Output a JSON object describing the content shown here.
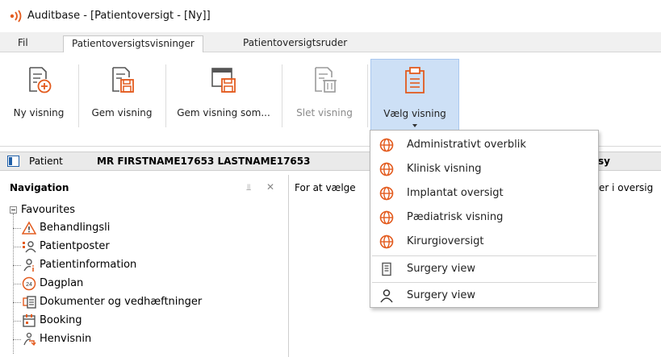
{
  "window": {
    "title": "Auditbase - [Patientoversigt - [Ny]]",
    "logo_icon": "signal-waves-icon"
  },
  "tabs": [
    {
      "label": "Fil",
      "active": false
    },
    {
      "label": "Patientoversigtsvisninger",
      "active": true
    },
    {
      "label": "Patientoversigtsruder",
      "active": false
    }
  ],
  "ribbon": {
    "buttons": [
      {
        "label": "Ny visning",
        "icon": "new-document-plus-icon",
        "enabled": true
      },
      {
        "label": "Gem visning",
        "icon": "save-document-icon",
        "enabled": true
      },
      {
        "label": "Gem visning som...",
        "icon": "save-as-window-icon",
        "enabled": true
      },
      {
        "label": "Slet visning",
        "icon": "delete-document-icon",
        "enabled": false
      },
      {
        "label": "Vælg visning",
        "icon": "clipboard-list-icon",
        "enabled": true,
        "selected": true
      }
    ]
  },
  "patient_bar": {
    "label": "Patient",
    "name": "MR FIRSTNAME17653 LASTNAME17653",
    "right_fragment": "sy"
  },
  "navigation": {
    "title": "Navigation",
    "root_label": "Favourites",
    "items": [
      {
        "label": "Behandlingsli",
        "icon": "warning-triangle-icon"
      },
      {
        "label": "Patientposter",
        "icon": "patient-records-icon"
      },
      {
        "label": "Patientinformation",
        "icon": "patient-info-icon"
      },
      {
        "label": "Dagplan",
        "icon": "24-hours-icon"
      },
      {
        "label": "Dokumenter og vedhæftninger",
        "icon": "documents-attachments-icon"
      },
      {
        "label": "Booking",
        "icon": "calendar-icon"
      },
      {
        "label": "Henvisnin",
        "icon": "referral-icon"
      }
    ]
  },
  "content": {
    "hint_left": "For at vælge",
    "hint_right": "er i oversig"
  },
  "dropdown": {
    "items": [
      {
        "label": "Administrativt overblik",
        "icon": "globe-icon"
      },
      {
        "label": "Klinisk visning",
        "icon": "globe-icon"
      },
      {
        "label": "Implantat oversigt",
        "icon": "globe-icon"
      },
      {
        "label": "Pædiatrisk visning",
        "icon": "globe-icon"
      },
      {
        "label": "Kirurgioversigt",
        "icon": "globe-icon"
      },
      {
        "label": "Surgery view",
        "icon": "document-list-icon"
      },
      {
        "label": "Surgery view",
        "icon": "user-icon"
      }
    ]
  },
  "colors": {
    "accent_orange": "#e35b1e",
    "selected_bg": "#cde0f6",
    "selected_border": "#a9c8ef",
    "icon_gray": "#555555",
    "disabled_gray": "#9a9a9a"
  }
}
